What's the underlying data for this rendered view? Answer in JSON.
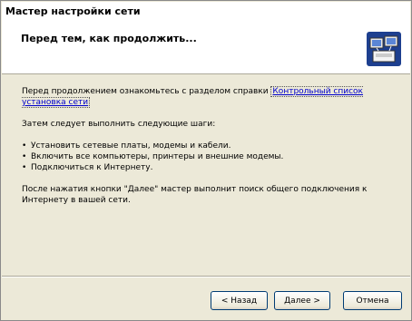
{
  "window": {
    "title": "Мастер настройки сети"
  },
  "header": {
    "title": "Перед тем, как продолжить...",
    "icon": "network-computers-icon"
  },
  "body": {
    "intro_text": "Перед продолжением ознакомьтесь с разделом справки ",
    "intro_link": "Контрольный список установка сети",
    "steps_intro": "Затем следует выполнить следующие шаги:",
    "steps": [
      "Установить сетевые платы, модемы и кабели.",
      "Включить все компьютеры, принтеры и внешние модемы.",
      "Подключиться к Интернету."
    ],
    "outro": "После нажатия кнопки \"Далее\" мастер выполнит поиск общего подключения к Интернету в вашей сети."
  },
  "buttons": {
    "back": "< Назад",
    "next": "Далее >",
    "cancel": "Отмена"
  }
}
